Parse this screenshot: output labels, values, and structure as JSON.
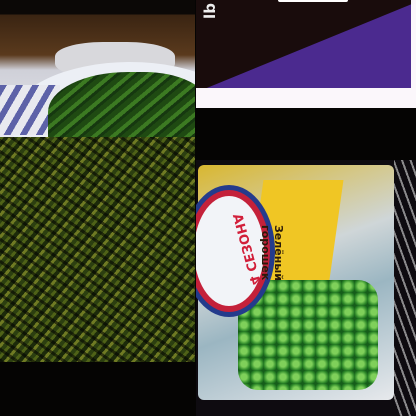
{
  "tiles": [
    {
      "subject": "green beans on plate"
    },
    {
      "subject": "cooked green beans close-up"
    },
    {
      "subject": "purple and black package",
      "text": "lb"
    },
    {
      "subject": "frozen green peas bag",
      "brand": "4 СЕЗОНА",
      "product_line1": "Зелёный",
      "product_line2": "горошек"
    }
  ],
  "colors": {
    "purple": "#4b2a8f",
    "bean_green": "#3c7a22",
    "bag_yellow": "#f0c624",
    "brand_red": "#c4213a"
  }
}
